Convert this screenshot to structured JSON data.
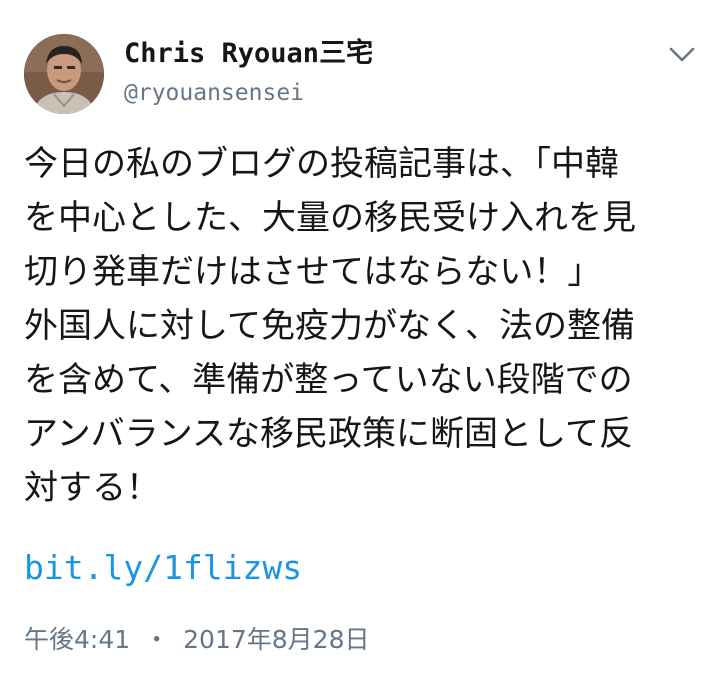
{
  "user": {
    "display_name": "Chris Ryouan三宅",
    "handle": "@ryouansensei",
    "avatar_icon": "avatar-photo"
  },
  "menu_icon": "chevron-down-icon",
  "tweet": {
    "lines": [
      "今日の私のブログの投稿記事は、「中韓",
      "を中心とした、大量の移民受け入れを見",
      "切り発車だけはさせてはならない！」",
      "外国人に対して免疫力がなく、法の整備",
      "を含めて、準備が整っていない段階での",
      "アンバランスな移民政策に断固として反",
      "対する！"
    ],
    "link": "bit.ly/1flizws",
    "time": "午後4:41",
    "separator": "・",
    "date": "2017年8月28日"
  },
  "colors": {
    "link": "#1b95e0",
    "secondary_text": "#657786",
    "primary_text": "#14171a"
  }
}
